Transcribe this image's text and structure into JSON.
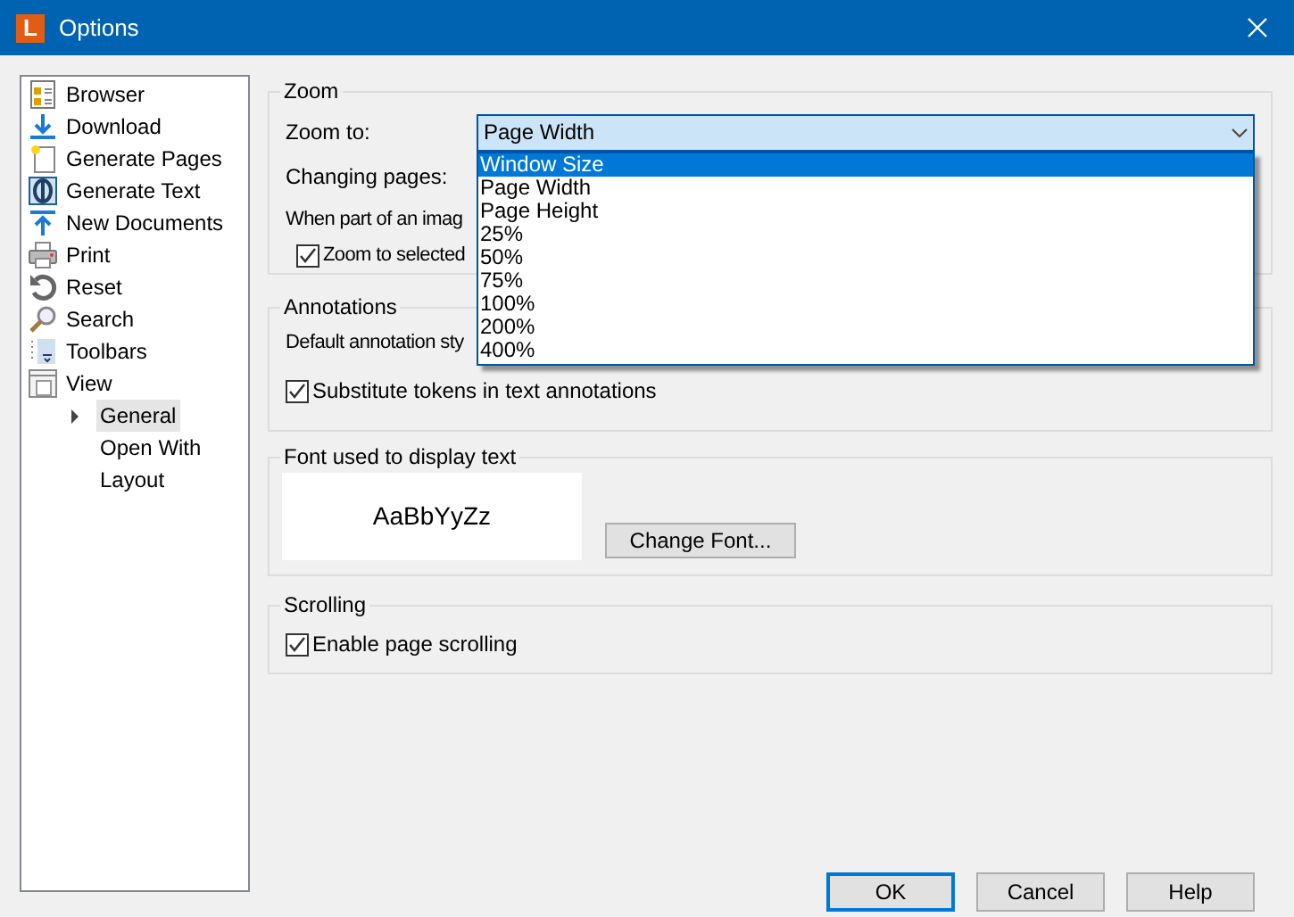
{
  "window": {
    "title": "Options",
    "icon_letter": "L"
  },
  "tree": [
    {
      "label": "Browser",
      "kind": "browser"
    },
    {
      "label": "Download",
      "kind": "download"
    },
    {
      "label": "Generate Pages",
      "kind": "pages"
    },
    {
      "label": "Generate Text",
      "kind": "text"
    },
    {
      "label": "New Documents",
      "kind": "upload"
    },
    {
      "label": "Print",
      "kind": "print"
    },
    {
      "label": "Reset",
      "kind": "reset"
    },
    {
      "label": "Search",
      "kind": "search"
    },
    {
      "label": "Toolbars",
      "kind": "toolbars"
    },
    {
      "label": "View",
      "kind": "view",
      "children": [
        {
          "label": "General",
          "selected": true,
          "expanded": false
        },
        {
          "label": "Open With",
          "selected": false
        },
        {
          "label": "Layout",
          "selected": false
        }
      ]
    }
  ],
  "zoom": {
    "title": "Zoom",
    "zoom_to_label": "Zoom to:",
    "zoom_to_value": "Page Width",
    "changing_pages_label": "Changing pages:",
    "image_label": "When part of an imag",
    "zoom_selected": {
      "label": "Zoom to selected",
      "checked": true
    },
    "dropdown": [
      {
        "label": "Window Size",
        "selected": true
      },
      {
        "label": "Page Width",
        "selected": false
      },
      {
        "label": "Page Height",
        "selected": false
      },
      {
        "label": "25%",
        "selected": false
      },
      {
        "label": "50%",
        "selected": false
      },
      {
        "label": "75%",
        "selected": false
      },
      {
        "label": "100%",
        "selected": false
      },
      {
        "label": "200%",
        "selected": false
      },
      {
        "label": "400%",
        "selected": false
      }
    ]
  },
  "annotations": {
    "title": "Annotations",
    "style_label": "Default annotation sty",
    "substitute": {
      "label": "Substitute tokens in text annotations",
      "checked": true
    }
  },
  "font": {
    "title": "Font used to display text",
    "sample": "AaBbYyZz",
    "button": "Change Font..."
  },
  "scrolling": {
    "title": "Scrolling",
    "enable": {
      "label": "Enable page scrolling",
      "checked": true
    }
  },
  "buttons": [
    {
      "label": "OK",
      "default": true
    },
    {
      "label": "Cancel",
      "default": false
    },
    {
      "label": "Help",
      "default": false
    }
  ]
}
